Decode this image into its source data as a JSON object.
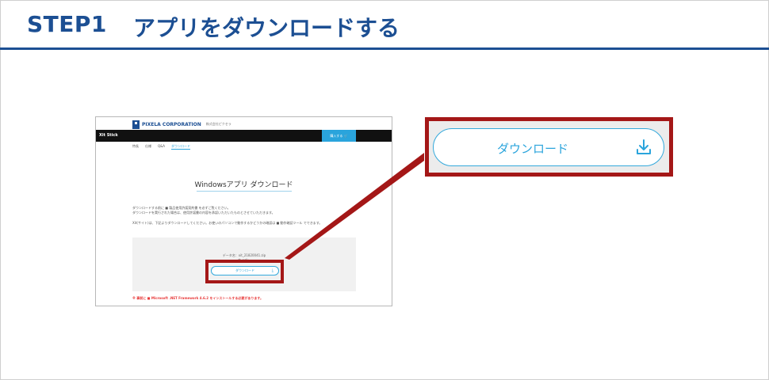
{
  "header": {
    "step": "STEP1",
    "title": "アプリをダウンロードする"
  },
  "screenshot": {
    "logo_text": "PIXELA CORPORATION",
    "logo_sub": "株式会社ピクセラ",
    "bar_title": "Xit Stick",
    "buy_label": "購入する",
    "nav": [
      "特長",
      "仕様",
      "Q&A",
      "ダウンロード"
    ],
    "heading": "Windowsアプリ ダウンロード",
    "para1": "ダウンロードする前に ■ 製品使用許諾契約書 を必ずご覧ください。",
    "para2": "ダウンロードを実行された場合は、使用許諾書の内容を承認いただいたものとさせていただきます。",
    "para3": "Xit(サイト)は、下記よりダウンロードしてください。お使いのパソコンで動作するかどうかの確認は ■ 動作確認ツール でできます。",
    "file_name": "データ名：xit_21820041.zip",
    "file_size": "サイズ：",
    "download_label": "ダウンロード",
    "warning": "※ 事前に ■ Microsoft .NET Framework 4.6.2 をインストールする必要があります。"
  },
  "callout": {
    "download_label": "ダウンロード",
    "icon": "download-icon",
    "highlight_color": "#a41717",
    "accent_color": "#2aa4dc"
  }
}
